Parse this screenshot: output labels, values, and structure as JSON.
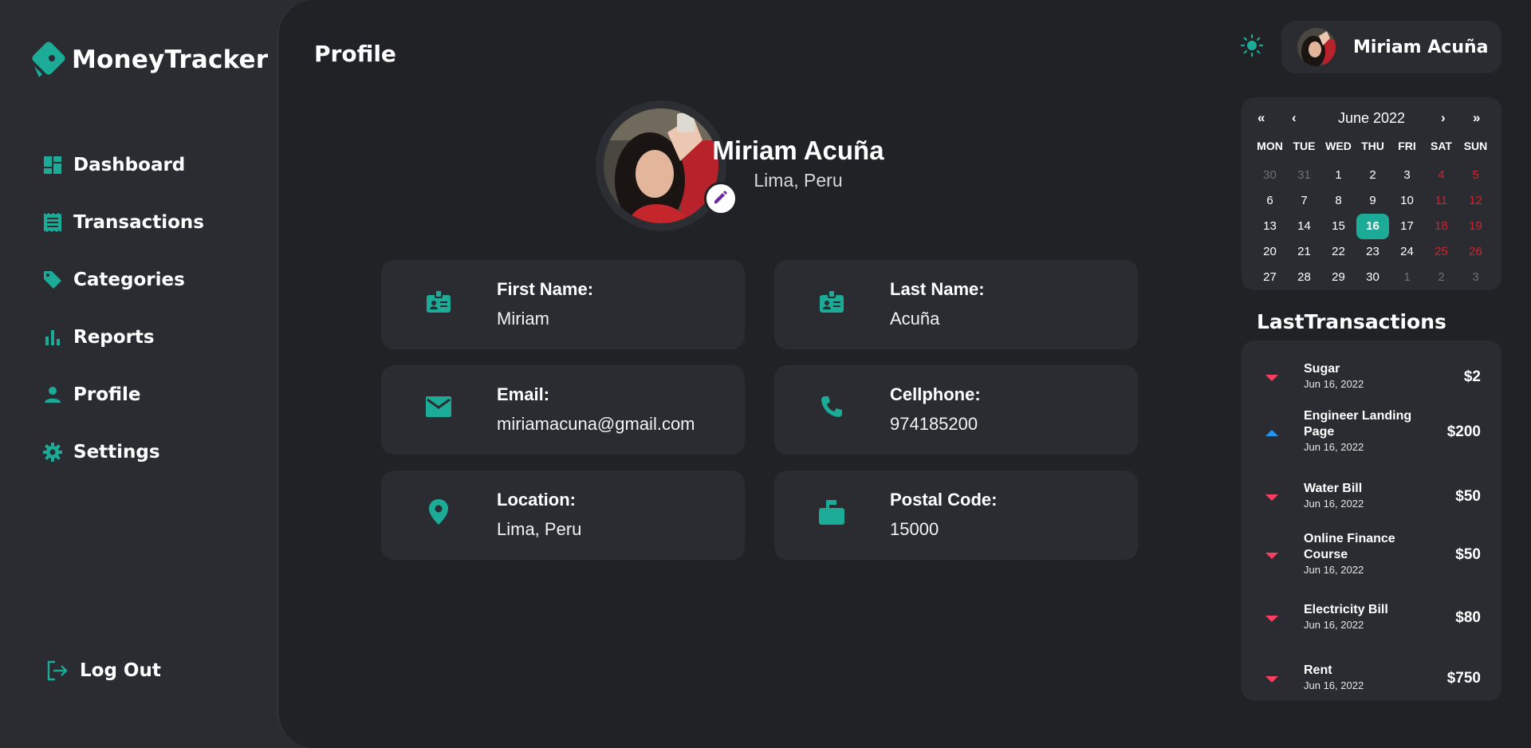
{
  "app": {
    "name": "MoneyTracker",
    "accent": "#1bab97"
  },
  "sidebar": {
    "items": [
      {
        "label": "Dashboard",
        "icon": "dashboard-icon"
      },
      {
        "label": "Transactions",
        "icon": "receipt-icon"
      },
      {
        "label": "Categories",
        "icon": "tag-icon"
      },
      {
        "label": "Reports",
        "icon": "bar-chart-icon"
      },
      {
        "label": "Profile",
        "icon": "person-icon"
      },
      {
        "label": "Settings",
        "icon": "gear-icon"
      }
    ],
    "logout": "Log Out"
  },
  "header": {
    "title": "Profile",
    "user_name": "Miriam Acuña",
    "theme_icon": "sun-icon"
  },
  "profile": {
    "name": "Miriam Acuña",
    "location": "Lima, Peru",
    "fields": [
      {
        "label": "First Name:",
        "value": "Miriam",
        "icon": "id-badge-icon"
      },
      {
        "label": "Last Name:",
        "value": "Acuña",
        "icon": "id-badge-icon"
      },
      {
        "label": "Email:",
        "value": "miriamacuna@gmail.com",
        "icon": "mail-icon"
      },
      {
        "label": "Cellphone:",
        "value": "974185200",
        "icon": "phone-icon"
      },
      {
        "label": "Location:",
        "value": "Lima, Peru",
        "icon": "location-pin-icon"
      },
      {
        "label": "Postal Code:",
        "value": "15000",
        "icon": "mailbox-icon"
      }
    ]
  },
  "calendar": {
    "title": "June 2022",
    "nav": {
      "prev_year": "«",
      "prev_month": "‹",
      "next_month": "›",
      "next_year": "»"
    },
    "weekdays": [
      "MON",
      "TUE",
      "WED",
      "THU",
      "FRI",
      "SAT",
      "SUN"
    ],
    "weeks": [
      [
        "30",
        "31",
        "1",
        "2",
        "3",
        "4",
        "5"
      ],
      [
        "6",
        "7",
        "8",
        "9",
        "10",
        "11",
        "12"
      ],
      [
        "13",
        "14",
        "15",
        "16",
        "17",
        "18",
        "19"
      ],
      [
        "20",
        "21",
        "22",
        "23",
        "24",
        "25",
        "26"
      ],
      [
        "27",
        "28",
        "29",
        "30",
        "1",
        "2",
        "3"
      ]
    ],
    "today": "16"
  },
  "last_transactions": {
    "title": "LastTransactions",
    "items": [
      {
        "name": "Sugar",
        "date": "Jun 16, 2022",
        "amount": "$2",
        "direction": "down"
      },
      {
        "name": "Engineer Landing Page",
        "date": "Jun 16, 2022",
        "amount": "$200",
        "direction": "up"
      },
      {
        "name": "Water Bill",
        "date": "Jun 16, 2022",
        "amount": "$50",
        "direction": "down"
      },
      {
        "name": "Online Finance Course",
        "date": "Jun 16, 2022",
        "amount": "$50",
        "direction": "down"
      },
      {
        "name": "Electricity Bill",
        "date": "Jun 16, 2022",
        "amount": "$80",
        "direction": "down"
      },
      {
        "name": "Rent",
        "date": "Jun 16, 2022",
        "amount": "$750",
        "direction": "down"
      }
    ],
    "colors": {
      "expense": "#ff3d60",
      "income": "#2196f3"
    }
  }
}
